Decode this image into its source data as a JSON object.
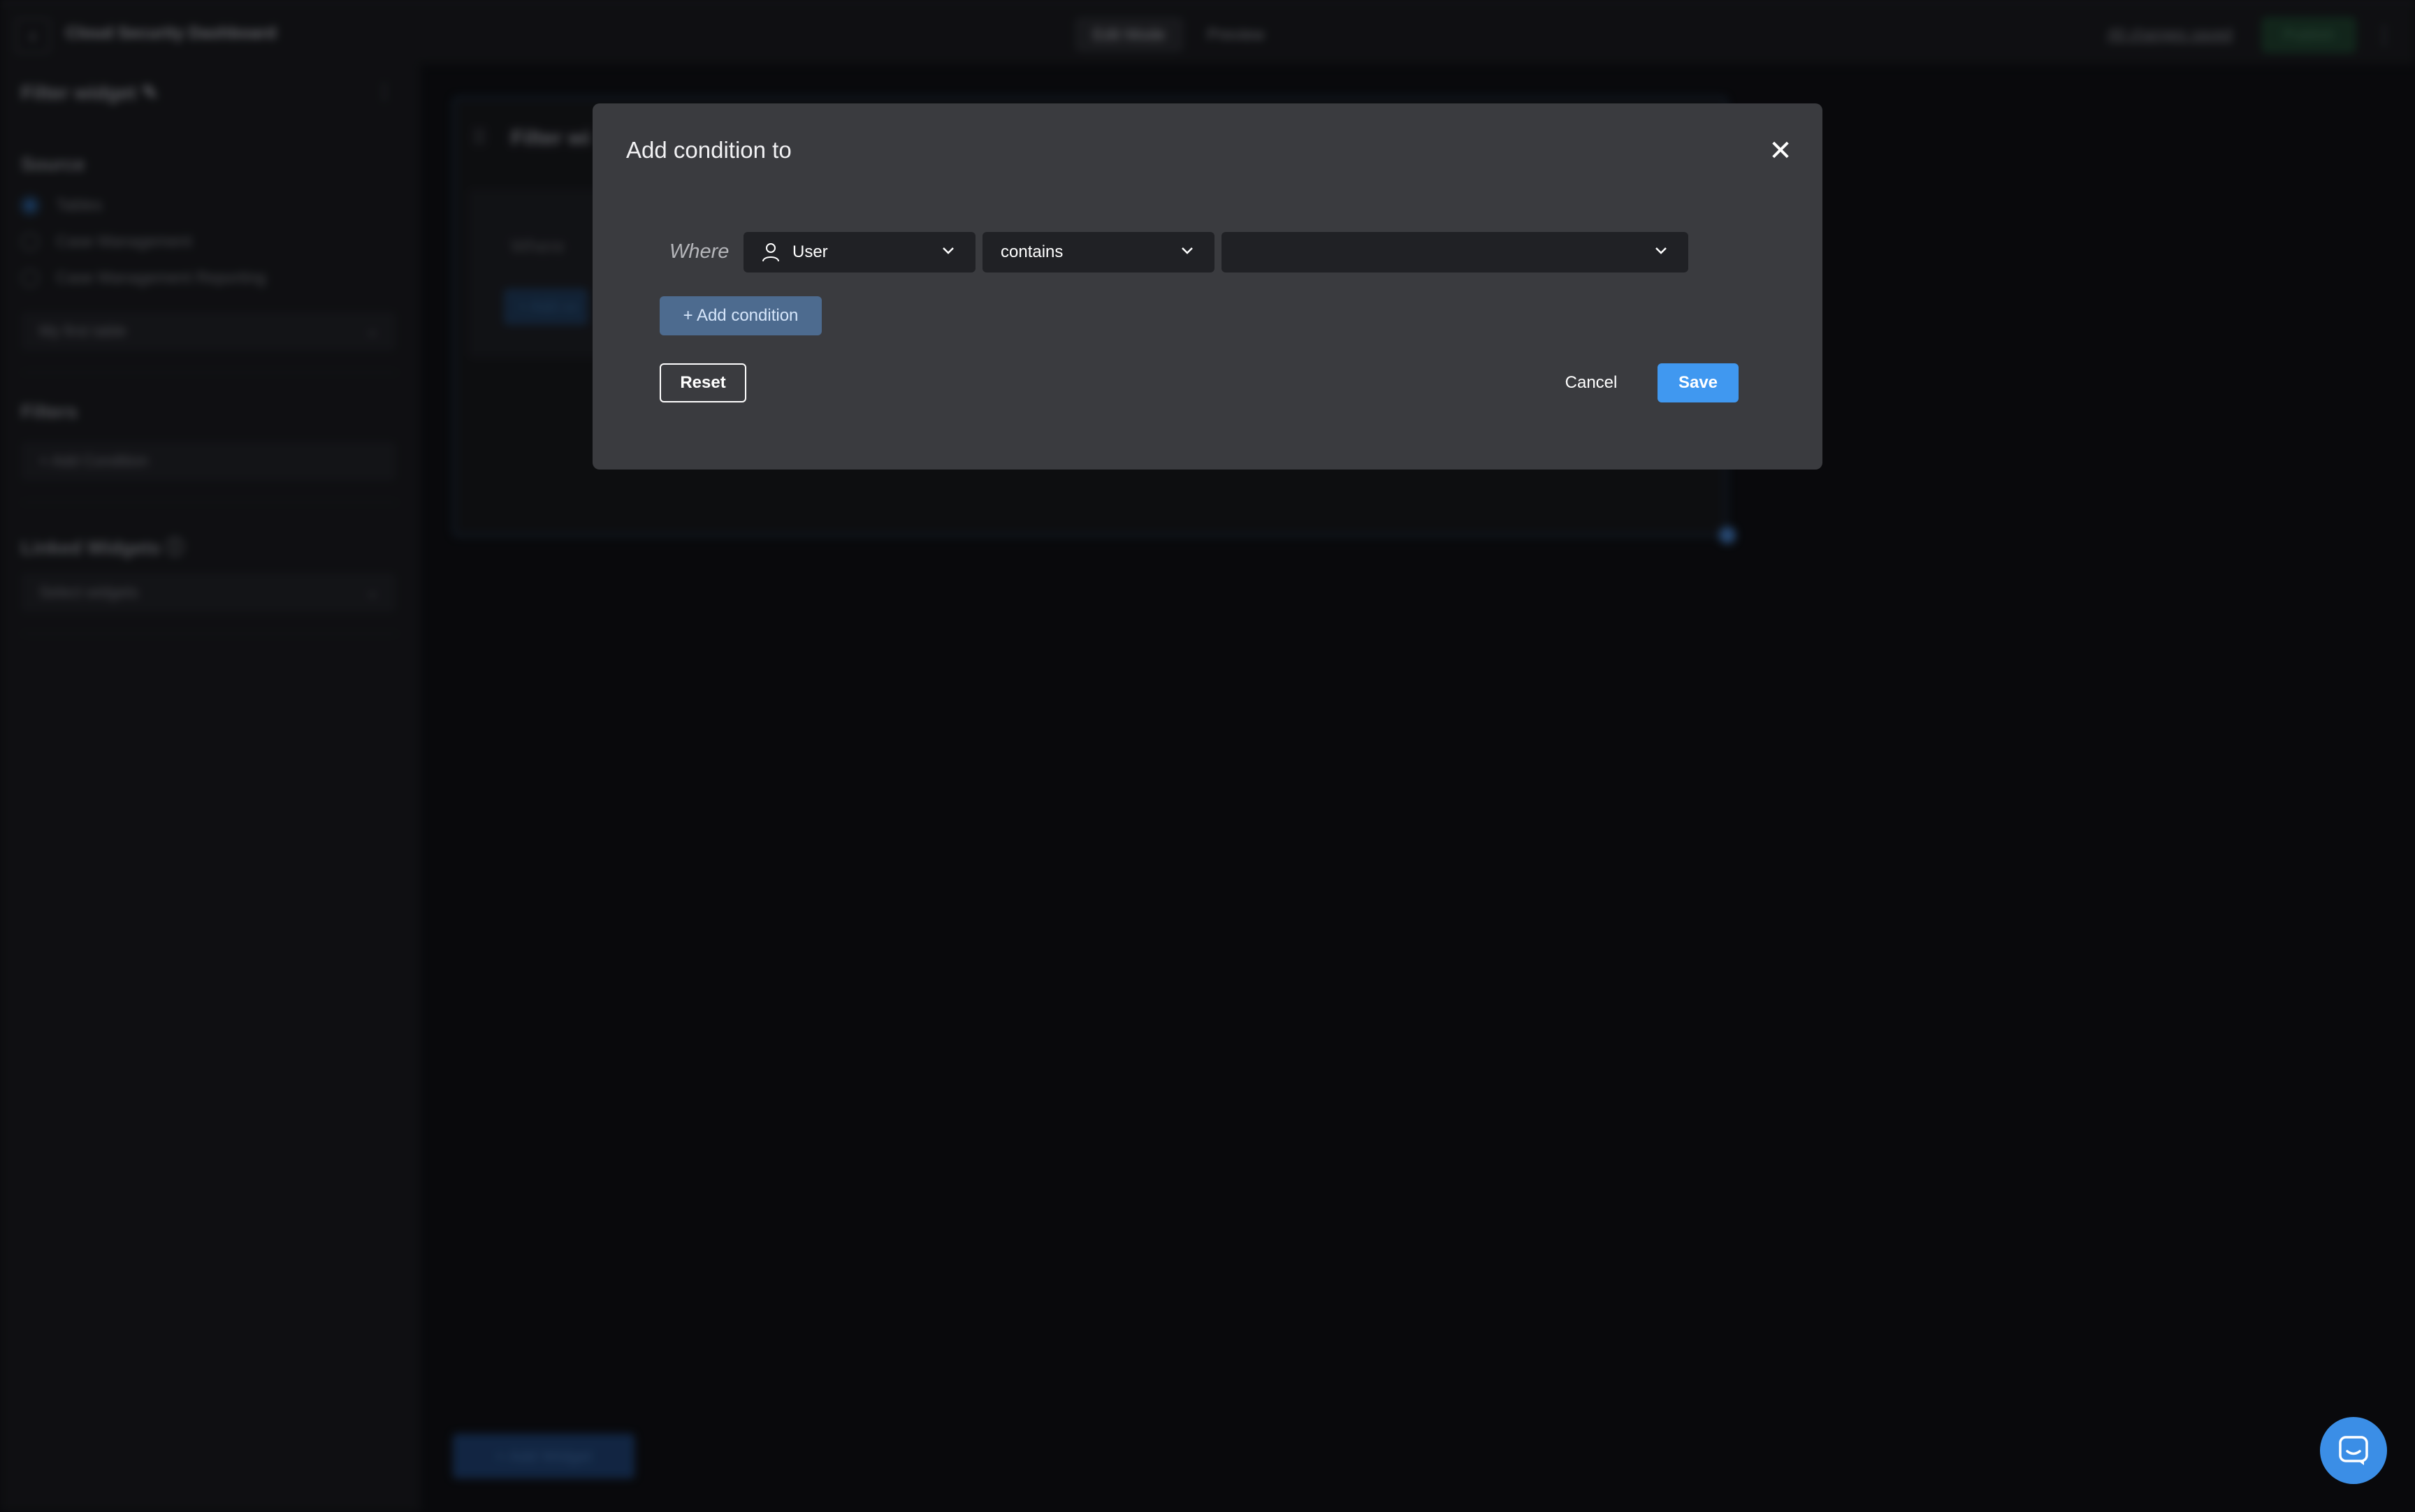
{
  "topbar": {
    "app_title": "Cloud Security Dashboard",
    "tabs": [
      {
        "label": "Edit Mode",
        "active": true
      },
      {
        "label": "Preview",
        "active": false
      }
    ],
    "saved_status": "All changes saved",
    "publish_label": "Publish"
  },
  "sidebar": {
    "title": "Filter widget",
    "source_heading": "Source",
    "sources": [
      {
        "label": "Tables",
        "selected": true
      },
      {
        "label": "Case Management",
        "selected": false
      },
      {
        "label": "Case Management Reporting",
        "selected": false
      }
    ],
    "table_select": "My first table",
    "filters_heading": "Filters",
    "add_condition_placeholder": "+ Add Condition",
    "linked_heading": "Linked Widgets",
    "linked_placeholder": "Select widgets"
  },
  "canvas": {
    "widget_title": "Filter wi",
    "where_label": "Where",
    "add_condition_short": "+ Add co",
    "add_widget_label": "+ Add Widget"
  },
  "modal": {
    "title": "Add condition to",
    "where_label": "Where",
    "field_value": "User",
    "operator_value": "contains",
    "value_value": "",
    "add_condition_label": "+ Add condition",
    "reset_label": "Reset",
    "cancel_label": "Cancel",
    "save_label": "Save"
  },
  "colors": {
    "accent": "#4098f0",
    "modal_bg": "#3a3b3f",
    "page_bg": "#0e0f13"
  }
}
